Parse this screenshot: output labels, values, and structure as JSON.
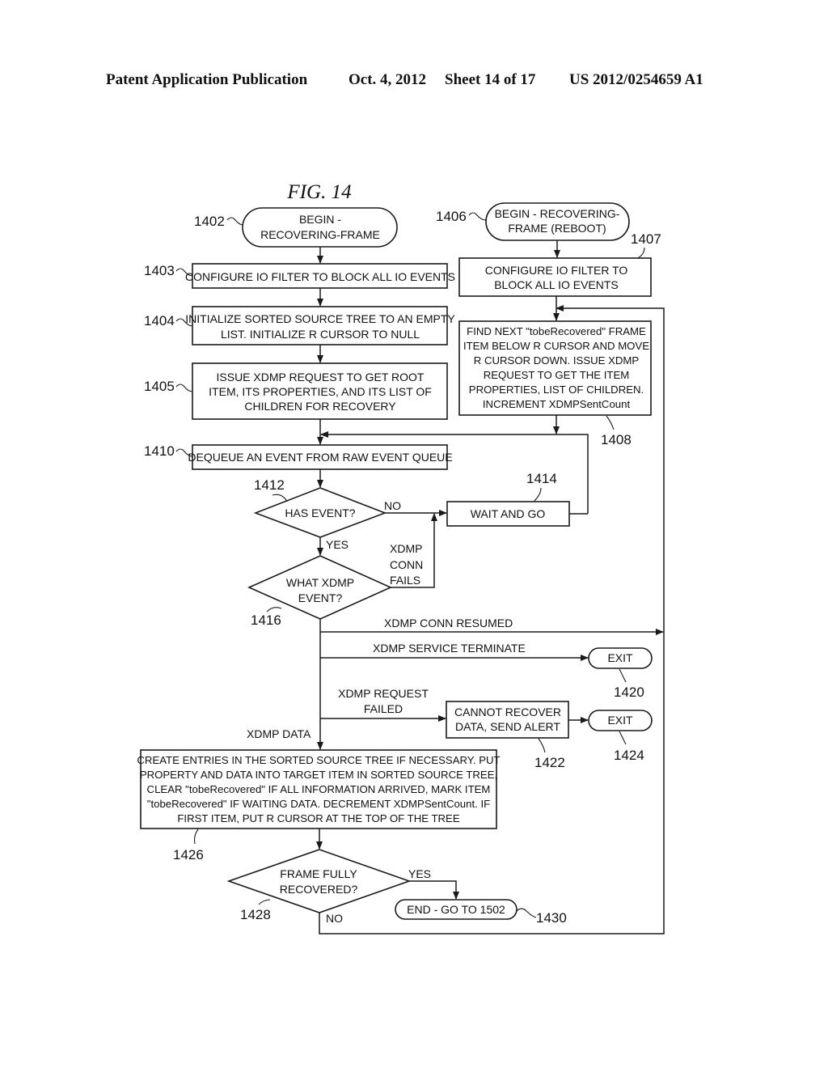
{
  "header": {
    "publication": "Patent Application Publication",
    "date": "Oct. 4, 2012",
    "sheet": "Sheet 14 of 17",
    "number": "US 2012/0254659 A1"
  },
  "figure": {
    "title": "FIG. 14",
    "nodes": {
      "n1402": {
        "ref": "1402",
        "lines": [
          "BEGIN -",
          "RECOVERING-FRAME"
        ]
      },
      "n1403": {
        "ref": "1403",
        "lines": [
          "CONFIGURE IO FILTER TO BLOCK ALL IO EVENTS"
        ]
      },
      "n1404": {
        "ref": "1404",
        "lines": [
          "INITIALIZE SORTED SOURCE TREE TO AN EMPTY",
          "LIST.  INITIALIZE R CURSOR TO NULL"
        ]
      },
      "n1405": {
        "ref": "1405",
        "lines": [
          "ISSUE XDMP REQUEST TO GET ROOT",
          "ITEM, ITS PROPERTIES, AND ITS LIST OF",
          "CHILDREN FOR RECOVERY"
        ]
      },
      "n1406": {
        "ref": "1406",
        "lines": [
          "BEGIN - RECOVERING-",
          "FRAME (REBOOT)"
        ]
      },
      "n1407": {
        "ref": "1407",
        "lines": [
          "CONFIGURE IO FILTER TO",
          "BLOCK ALL IO EVENTS"
        ]
      },
      "n1408": {
        "ref": "1408",
        "lines": [
          "FIND NEXT \"tobeRecovered\" FRAME",
          "ITEM BELOW R CURSOR AND MOVE",
          "R CURSOR DOWN.  ISSUE XDMP",
          "REQUEST TO GET THE ITEM",
          "PROPERTIES, LIST OF CHILDREN.",
          "INCREMENT XDMPSentCount"
        ]
      },
      "n1410": {
        "ref": "1410",
        "lines": [
          "DEQUEUE AN EVENT FROM RAW EVENT QUEUE"
        ]
      },
      "n1412": {
        "ref": "1412",
        "lines": [
          "HAS EVENT?"
        ]
      },
      "n1414": {
        "ref": "1414",
        "lines": [
          "WAIT AND GO"
        ]
      },
      "n1416": {
        "ref": "1416",
        "lines": [
          "WHAT XDMP",
          "EVENT?"
        ]
      },
      "n1420": {
        "ref": "1420",
        "lines": [
          "EXIT"
        ]
      },
      "n1422": {
        "ref": "1422",
        "lines": [
          "CANNOT RECOVER",
          "DATA, SEND ALERT"
        ]
      },
      "n1424": {
        "ref": "1424",
        "lines": [
          "EXIT"
        ]
      },
      "n1426": {
        "ref": "1426",
        "lines": [
          "CREATE ENTRIES IN THE SORTED SOURCE TREE IF NECESSARY.  PUT",
          "PROPERTY AND DATA INTO TARGET ITEM IN SORTED SOURCE TREE,",
          "CLEAR \"tobeRecovered\" IF ALL INFORMATION ARRIVED, MARK ITEM",
          "\"tobeRecovered\" IF WAITING DATA.  DECREMENT XDMPSentCount.  IF",
          "FIRST ITEM, PUT R CURSOR AT THE TOP OF THE TREE"
        ]
      },
      "n1428": {
        "ref": "1428",
        "lines": [
          "FRAME FULLY",
          "RECOVERED?"
        ]
      },
      "n1430": {
        "ref": "1430",
        "lines": [
          "END - GO TO 1502"
        ]
      }
    },
    "edge_labels": {
      "no_1412": "NO",
      "yes_1412": "YES",
      "conn_fails": [
        "XDMP",
        "CONN",
        "FAILS"
      ],
      "conn_resumed": "XDMP CONN RESUMED",
      "service_terminate": "XDMP SERVICE TERMINATE",
      "request_failed": [
        "XDMP REQUEST",
        "FAILED"
      ],
      "xdmp_data": "XDMP DATA",
      "yes_1428": "YES",
      "no_1428": "NO"
    }
  }
}
